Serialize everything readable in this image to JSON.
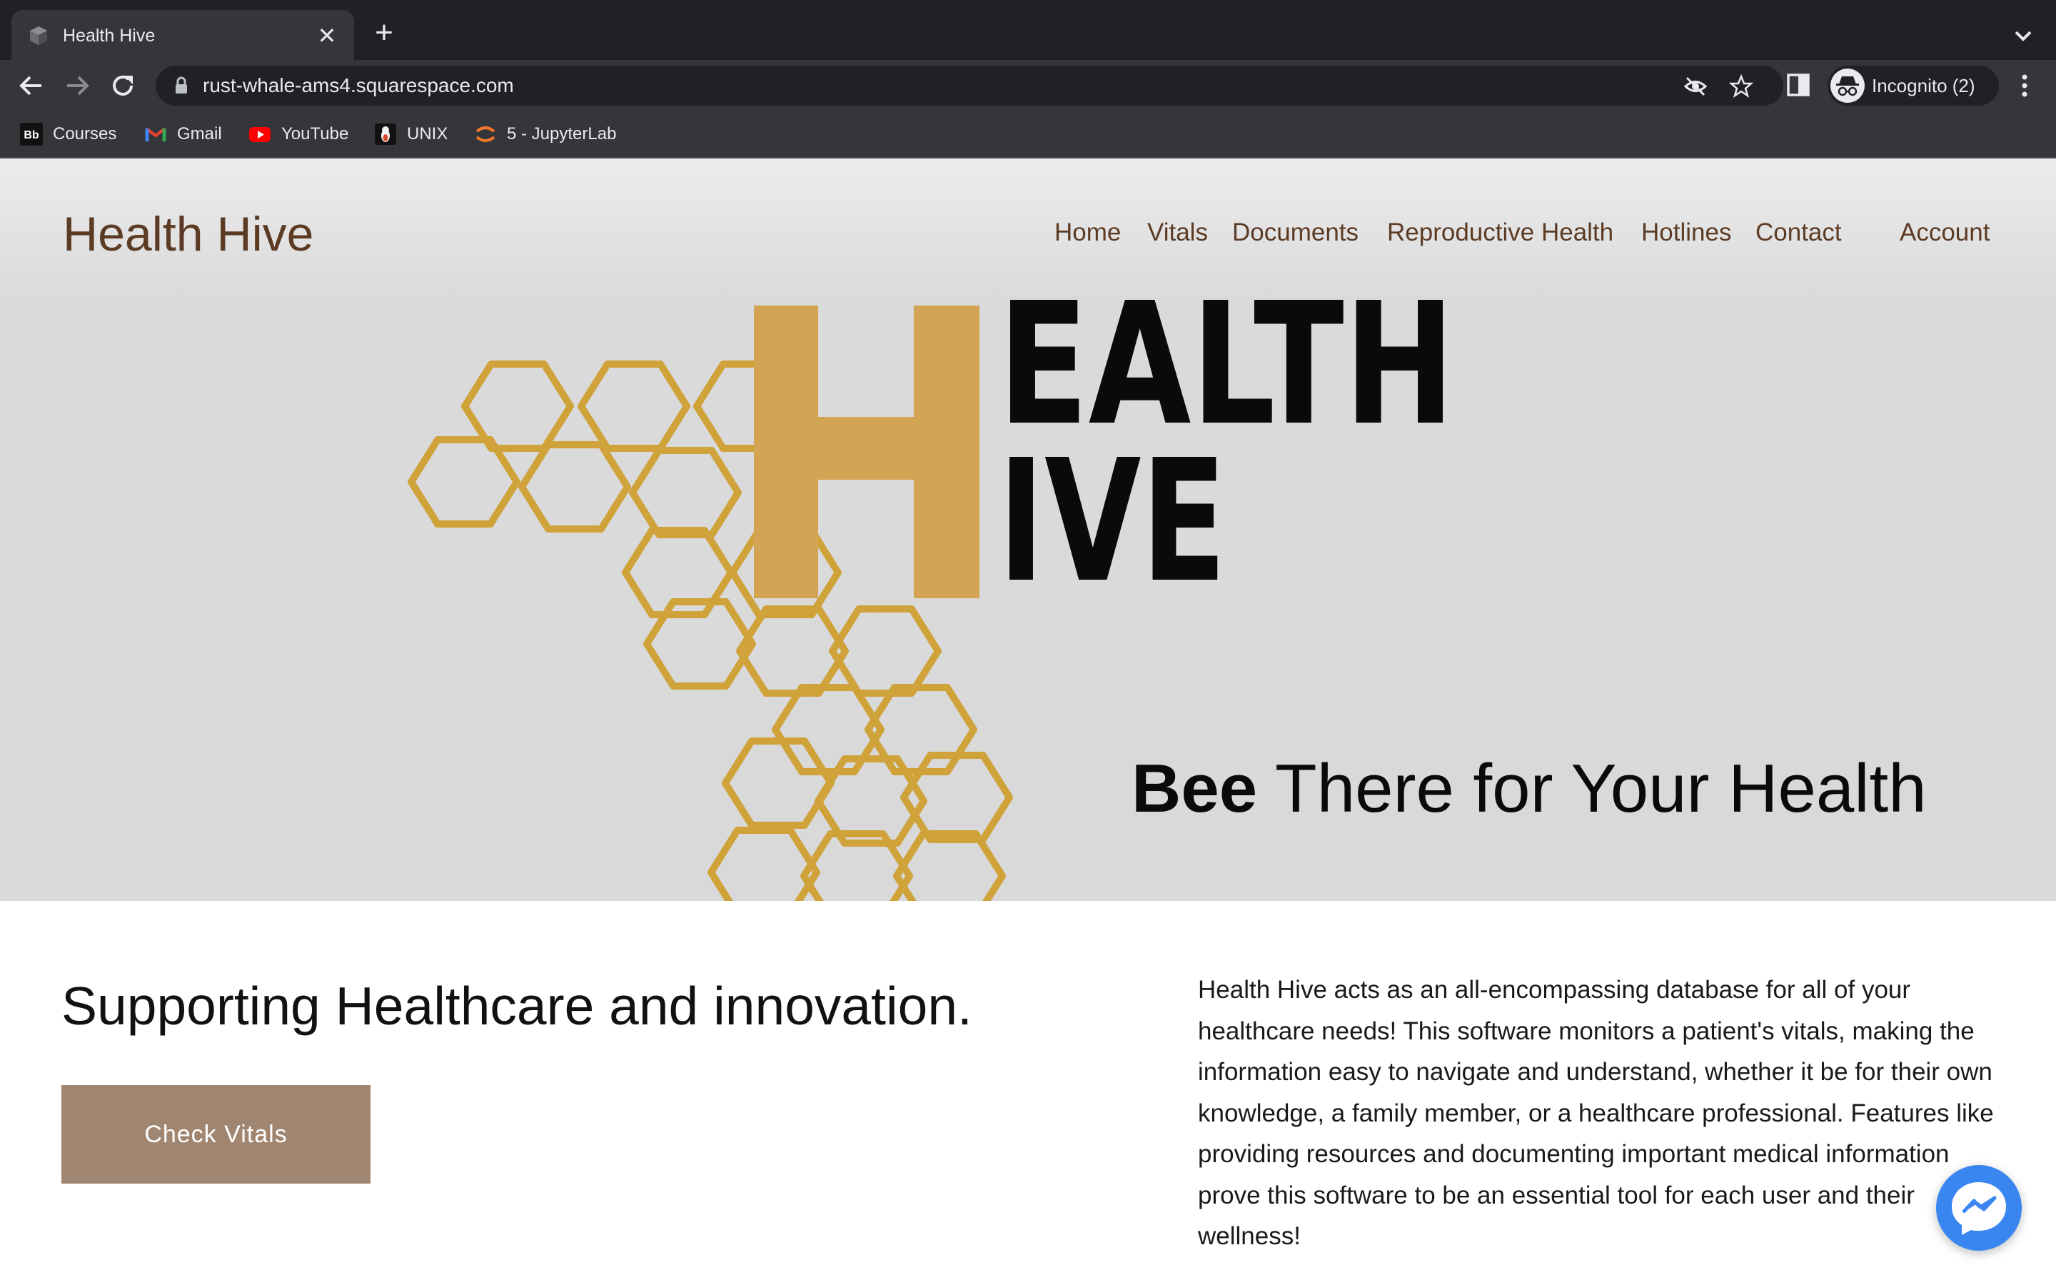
{
  "browser": {
    "tab": {
      "title": "Health Hive",
      "close_glyph": "✕"
    },
    "new_tab_glyph": "+",
    "url": "rust-whale-ams4.squarespace.com",
    "profile_label": "Incognito (2)",
    "bookmarks": [
      {
        "label": "Courses",
        "icon": "blackboard-icon"
      },
      {
        "label": "Gmail",
        "icon": "gmail-icon"
      },
      {
        "label": "YouTube",
        "icon": "youtube-icon"
      },
      {
        "label": "UNIX",
        "icon": "unix-icon"
      },
      {
        "label": "5 - JupyterLab",
        "icon": "jupyter-icon"
      }
    ],
    "bookmark_bb_text": "Bb"
  },
  "site": {
    "title": "Health Hive",
    "nav": [
      "Home",
      "Vitals",
      "Documents",
      "Reproductive Health",
      "Hotlines",
      "Contact",
      "Account"
    ],
    "logo": {
      "letter": "H",
      "line1": "EALTH",
      "line2": "IVE"
    },
    "tagline_bold": "Bee",
    "tagline_rest": " There for Your Health",
    "headline": "Supporting Healthcare and innovation.",
    "cta_label": "Check Vitals",
    "description": "Health Hive acts as an all-encompassing database for all of your healthcare needs! This software monitors a patient's vitals, making the information easy to navigate and understand, whether it be for their own knowledge, a family member, or a healthcare professional. Features like providing resources and documenting important medical information prove this software to be an essential tool for each user and their wellness!"
  },
  "colors": {
    "brand_brown": "#5c3b24",
    "honey_gold": "#d4a455",
    "hex_outline": "#d0a23a",
    "cta_bg": "#a08670",
    "messenger_blue": "#3a86f0"
  }
}
